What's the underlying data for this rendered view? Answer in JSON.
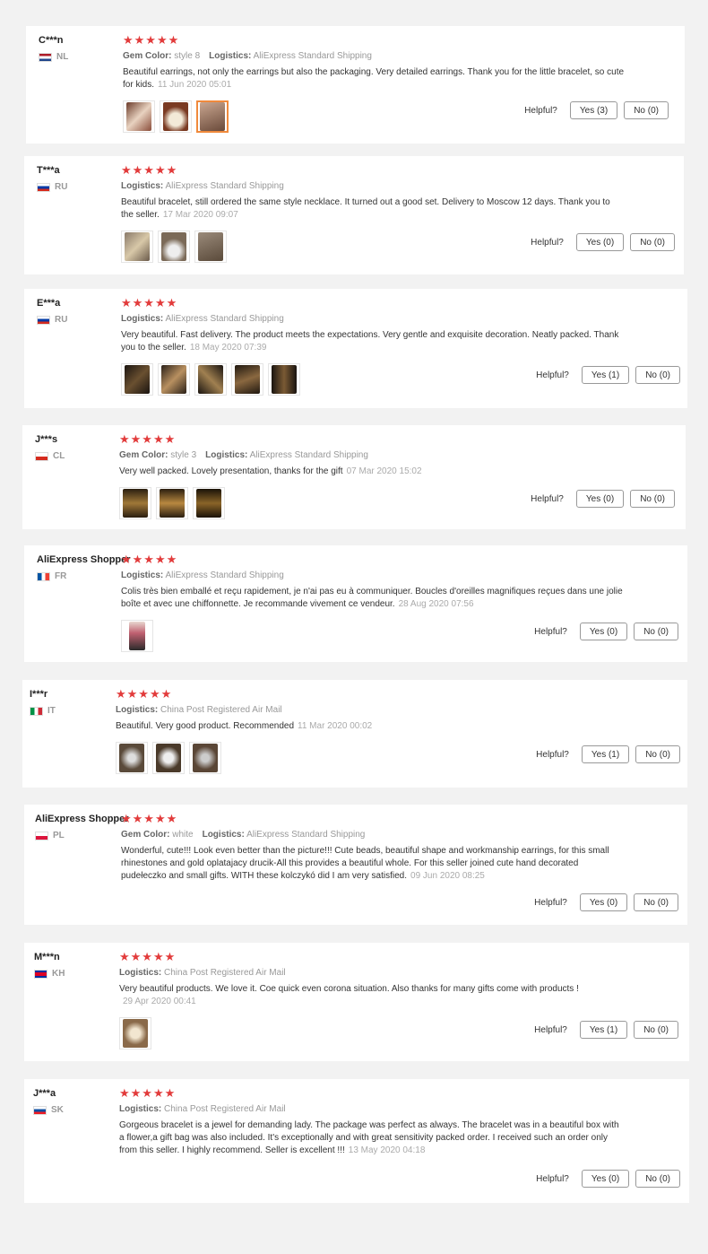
{
  "helpful_label": "Helpful?",
  "reviews": [
    {
      "user": "C***n",
      "country": "NL",
      "flag": "nl",
      "stars": "★★★★★",
      "gem_label": "Gem Color:",
      "gem_value": "style 8",
      "logistics_label": "Logistics:",
      "logistics_value": "AliExpress Standard Shipping",
      "text": "Beautiful earrings, not only the earrings but also the packaging. Very detailed earrings. Thank you for the little bracelet, so cute for kids.",
      "date": "11 Jun 2020 05:01",
      "photos": 3,
      "yes": "Yes (3)",
      "no": "No (0)"
    },
    {
      "user": "T***a",
      "country": "RU",
      "flag": "ru",
      "stars": "★★★★★",
      "logistics_label": "Logistics:",
      "logistics_value": "AliExpress Standard Shipping",
      "text": "Beautiful bracelet, still ordered the same style necklace. It turned out a good set. Delivery to Moscow 12 days. Thank you to the seller.",
      "date": "17 Mar 2020 09:07",
      "photos": 3,
      "yes": "Yes (0)",
      "no": "No (0)"
    },
    {
      "user": "E***a",
      "country": "RU",
      "flag": "ru",
      "stars": "★★★★★",
      "logistics_label": "Logistics:",
      "logistics_value": "AliExpress Standard Shipping",
      "text": "Very beautiful. Fast delivery. The product meets the expectations. Very gentle and exquisite decoration. Neatly packed. Thank you to the seller.",
      "date": "18 May 2020 07:39",
      "photos": 5,
      "yes": "Yes (1)",
      "no": "No (0)"
    },
    {
      "user": "J***s",
      "country": "CL",
      "flag": "cl",
      "stars": "★★★★★",
      "gem_label": "Gem Color:",
      "gem_value": "style 3",
      "logistics_label": "Logistics:",
      "logistics_value": "AliExpress Standard Shipping",
      "text": "Very well packed. Lovely presentation, thanks for the gift",
      "date": "07 Mar 2020 15:02",
      "photos": 3,
      "yes": "Yes (0)",
      "no": "No (0)"
    },
    {
      "user": "AliExpress Shopper",
      "country": "FR",
      "flag": "fr",
      "stars": "★★★★★",
      "logistics_label": "Logistics:",
      "logistics_value": "AliExpress Standard Shipping",
      "text": "Colis très bien emballé et reçu rapidement, je n'ai pas eu à communiquer. Boucles d'oreilles magnifiques reçues dans une jolie boîte et avec une chiffonnette. Je recommande vivement ce vendeur.",
      "date": "28 Aug 2020 07:56",
      "photos": 1,
      "yes": "Yes (0)",
      "no": "No (0)"
    },
    {
      "user": "I***r",
      "country": "IT",
      "flag": "it",
      "stars": "★★★★★",
      "logistics_label": "Logistics:",
      "logistics_value": "China Post Registered Air Mail",
      "text": "Beautiful. Very good product. Recommended",
      "date": "11 Mar 2020 00:02",
      "photos": 3,
      "yes": "Yes (1)",
      "no": "No (0)"
    },
    {
      "user": "AliExpress Shopper",
      "country": "PL",
      "flag": "pl",
      "stars": "★★★★★",
      "gem_label": "Gem Color:",
      "gem_value": "white",
      "logistics_label": "Logistics:",
      "logistics_value": "AliExpress Standard Shipping",
      "text": "Wonderful, cute!!! Look even better than the picture!!! Cute beads, beautiful shape and workmanship earrings, for this small rhinestones and gold oplatajacy drucik-All this provides a beautiful whole. For this seller joined cute hand decorated pudełeczko and small gifts. WITH these kolczykó did I am very satisfied.",
      "date": "09 Jun 2020 08:25",
      "photos": 0,
      "yes": "Yes (0)",
      "no": "No (0)"
    },
    {
      "user": "M***n",
      "country": "KH",
      "flag": "kh",
      "stars": "★★★★★",
      "logistics_label": "Logistics:",
      "logistics_value": "China Post Registered Air Mail",
      "text": "Very beautiful products. We love it. Coe quick even corona situation. Also thanks for many gifts come with products !",
      "date": "29 Apr 2020 00:41",
      "photos": 1,
      "yes": "Yes (1)",
      "no": "No (0)"
    },
    {
      "user": "J***a",
      "country": "SK",
      "flag": "sk",
      "stars": "★★★★★",
      "logistics_label": "Logistics:",
      "logistics_value": "China Post Registered Air Mail",
      "text": "Gorgeous bracelet is a jewel for demanding lady. The package was perfect as always. The bracelet was in a beautiful box with a flower,a gift bag was also included. It's exceptionally and with great sensitivity packed order. I received such an order only from this seller. I highly recommend. Seller is excellent !!!",
      "date": "13 May 2020 04:18",
      "photos": 0,
      "yes": "Yes (0)",
      "no": "No (0)"
    }
  ]
}
